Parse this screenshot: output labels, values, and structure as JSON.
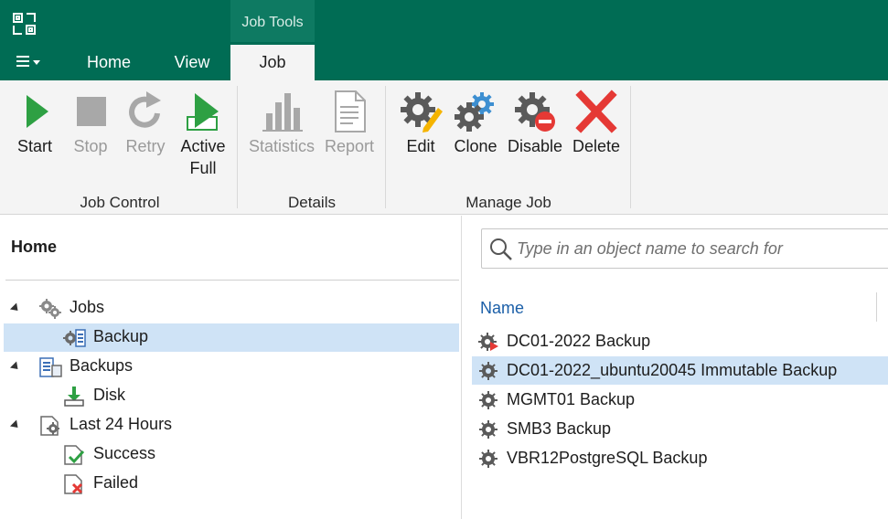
{
  "context_group": "Job Tools",
  "tabs": {
    "home": "Home",
    "view": "View",
    "job": "Job"
  },
  "ribbon": {
    "job_control": {
      "label": "Job Control",
      "start": "Start",
      "stop": "Stop",
      "retry": "Retry",
      "active_full_1": "Active",
      "active_full_2": "Full"
    },
    "details": {
      "label": "Details",
      "statistics": "Statistics",
      "report": "Report"
    },
    "manage_job": {
      "label": "Manage Job",
      "edit": "Edit",
      "clone": "Clone",
      "disable": "Disable",
      "delete": "Delete"
    }
  },
  "nav": {
    "title": "Home",
    "tree": [
      {
        "label": "Jobs"
      },
      {
        "label": "Backup"
      },
      {
        "label": "Backups"
      },
      {
        "label": "Disk"
      },
      {
        "label": "Last 24 Hours"
      },
      {
        "label": "Success"
      },
      {
        "label": "Failed"
      }
    ]
  },
  "search": {
    "placeholder": "Type in an object name to search for"
  },
  "list": {
    "column_name": "Name",
    "rows": [
      {
        "name": "DC01-2022 Backup"
      },
      {
        "name": "DC01-2022_ubuntu20045 Immutable Backup"
      },
      {
        "name": "MGMT01 Backup"
      },
      {
        "name": "SMB3 Backup"
      },
      {
        "name": "VBR12PostgreSQL Backup"
      }
    ]
  },
  "colors": {
    "title_bar": "#006c54",
    "ribbon_bg": "#f4f4f4",
    "selection": "#cfe3f6",
    "start_green": "#2ea043",
    "delete_red": "#e53935",
    "link_blue": "#1b5fa8"
  }
}
